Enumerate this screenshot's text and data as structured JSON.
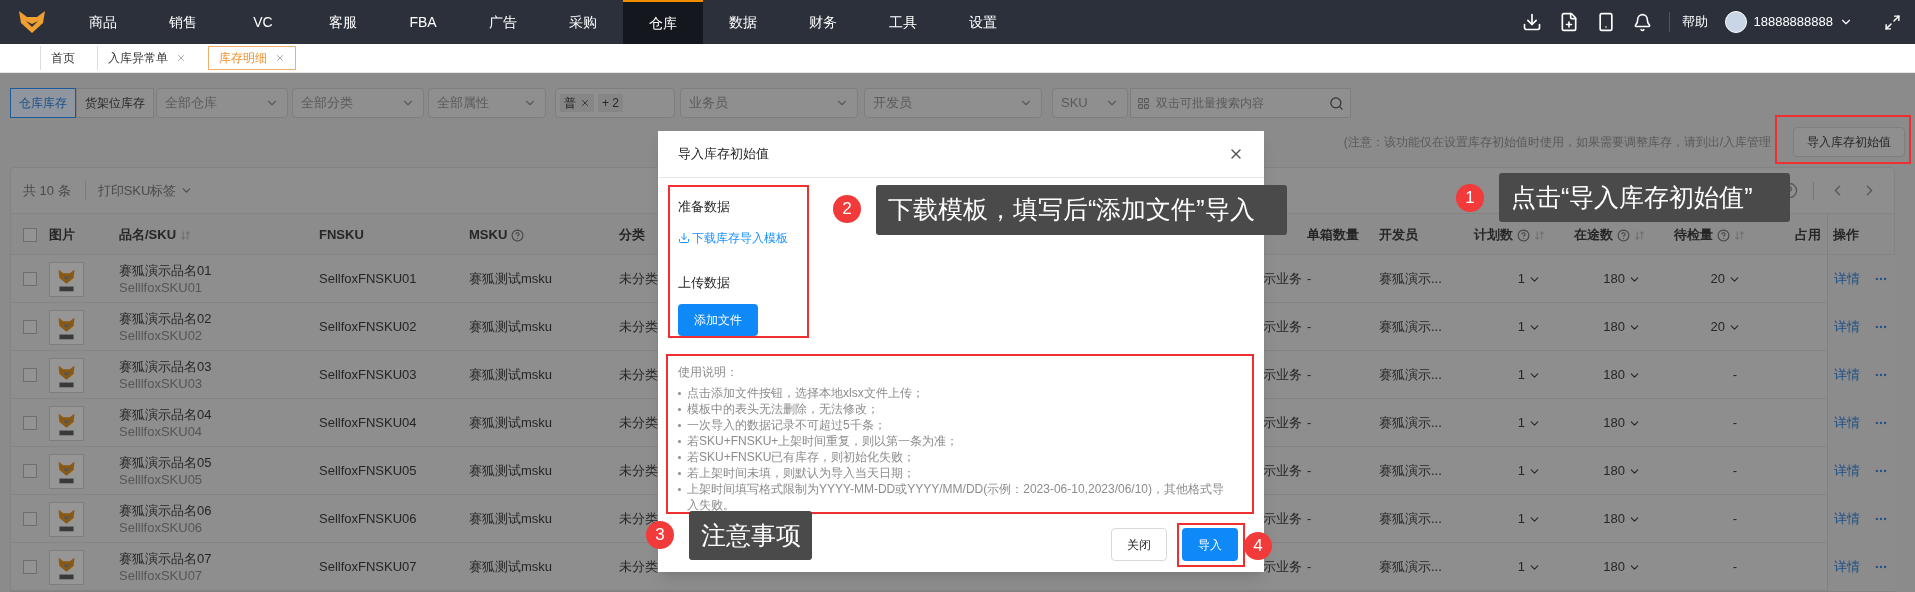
{
  "nav": {
    "items": [
      {
        "label": "商品",
        "selected": false
      },
      {
        "label": "销售",
        "selected": false
      },
      {
        "label": "VC",
        "selected": false
      },
      {
        "label": "客服",
        "selected": false
      },
      {
        "label": "FBA",
        "selected": false
      },
      {
        "label": "广告",
        "selected": false
      },
      {
        "label": "采购",
        "selected": false
      },
      {
        "label": "仓库",
        "selected": true
      },
      {
        "label": "数据",
        "selected": false
      },
      {
        "label": "财务",
        "selected": false
      },
      {
        "label": "工具",
        "selected": false
      },
      {
        "label": "设置",
        "selected": false
      }
    ],
    "help": "帮助",
    "user": "18888888888"
  },
  "tabs": [
    {
      "label": "首页",
      "closable": false,
      "selected": false
    },
    {
      "label": "入库异常单",
      "closable": true,
      "selected": false
    },
    {
      "label": "库存明细",
      "closable": true,
      "selected": true
    }
  ],
  "filters": {
    "views": [
      {
        "label": "仓库库存",
        "selected": true
      },
      {
        "label": "货架位库存",
        "selected": false
      }
    ],
    "selects": [
      {
        "placeholder": "全部仓库"
      },
      {
        "placeholder": "全部分类"
      },
      {
        "placeholder": "全部属性"
      }
    ],
    "tag_select": {
      "tag": "普",
      "more": "+ 2"
    },
    "people": [
      {
        "placeholder": "业务员"
      },
      {
        "placeholder": "开发员"
      }
    ],
    "search_type": "SKU",
    "search": {
      "placeholder": "双击可批量搜索内容"
    }
  },
  "notice": "(注意：该功能仅在设置库存初始值时使用，如果需要调整库存，请到出/入库管理",
  "import_button": "导入库存初始值",
  "table": {
    "total": "共 10 条",
    "print_button": "打印SKU标签",
    "all_checked": false,
    "columns": [
      {
        "label": "图片",
        "help": false,
        "sortable": false
      },
      {
        "label": "品名/SKU",
        "help": false,
        "sortable": true
      },
      {
        "label": "FNSKU",
        "help": false,
        "sortable": false
      },
      {
        "label": "MSKU",
        "help": true,
        "sortable": false
      },
      {
        "label": "分类",
        "help": false,
        "sortable": false
      },
      {
        "label": "单箱数量",
        "help": false,
        "sortable": false
      },
      {
        "label": "开发员",
        "help": false,
        "sortable": false
      },
      {
        "label": "计划数",
        "help": true,
        "sortable": true
      },
      {
        "label": "在途数",
        "help": true,
        "sortable": true
      },
      {
        "label": "待检量",
        "help": true,
        "sortable": true
      },
      {
        "label": "占用"
      },
      {
        "label": "操作",
        "help": false,
        "sortable": false
      }
    ],
    "rows": [
      {
        "checked": false,
        "name": "赛狐演示品名01",
        "sku": "SelllfoxSKU01",
        "fnsku": "SellfoxFNSKU01",
        "msku": "赛狐测试msku",
        "category": "未分类",
        "column_7": "示业务",
        "box_qty": "-",
        "developer": "赛狐演示...",
        "planned": "1",
        "in_transit": "180",
        "pending": "20",
        "pending_expandable": true,
        "action": "详情"
      },
      {
        "checked": false,
        "name": "赛狐演示品名02",
        "sku": "SelllfoxSKU02",
        "fnsku": "SellfoxFNSKU02",
        "msku": "赛狐测试msku",
        "category": "未分类",
        "column_7": "示业务",
        "box_qty": "-",
        "developer": "赛狐演示...",
        "planned": "1",
        "in_transit": "180",
        "pending": "20",
        "pending_expandable": true,
        "action": "详情"
      },
      {
        "checked": false,
        "name": "赛狐演示品名03",
        "sku": "SelllfoxSKU03",
        "fnsku": "SellfoxFNSKU03",
        "msku": "赛狐测试msku",
        "category": "未分类",
        "column_7": "示业务",
        "box_qty": "-",
        "developer": "赛狐演示...",
        "planned": "1",
        "in_transit": "180",
        "pending": "-",
        "pending_expandable": false,
        "action": "详情"
      },
      {
        "checked": false,
        "name": "赛狐演示品名04",
        "sku": "SelllfoxSKU04",
        "fnsku": "SellfoxFNSKU04",
        "msku": "赛狐测试msku",
        "category": "未分类",
        "column_7": "示业务",
        "box_qty": "-",
        "developer": "赛狐演示...",
        "planned": "1",
        "in_transit": "180",
        "pending": "-",
        "pending_expandable": false,
        "action": "详情"
      },
      {
        "checked": false,
        "name": "赛狐演示品名05",
        "sku": "SelllfoxSKU05",
        "fnsku": "SellfoxFNSKU05",
        "msku": "赛狐测试msku",
        "category": "未分类",
        "column_7": "示业务",
        "box_qty": "-",
        "developer": "赛狐演示...",
        "planned": "1",
        "in_transit": "180",
        "pending": "-",
        "pending_expandable": false,
        "action": "详情"
      },
      {
        "checked": false,
        "name": "赛狐演示品名06",
        "sku": "SelllfoxSKU06",
        "fnsku": "SellfoxFNSKU06",
        "msku": "赛狐测试msku",
        "category": "未分类",
        "column_7": "示业务",
        "box_qty": "-",
        "developer": "赛狐演示...",
        "planned": "1",
        "in_transit": "180",
        "pending": "-",
        "pending_expandable": false,
        "action": "详情"
      },
      {
        "checked": false,
        "name": "赛狐演示品名07",
        "sku": "SelllfoxSKU07",
        "fnsku": "SellfoxFNSKU07",
        "msku": "赛狐测试msku",
        "category": "未分类",
        "column_7": "示业务",
        "box_qty": "-",
        "developer": "赛狐演示...",
        "planned": "1",
        "in_transit": "180",
        "pending": "-",
        "pending_expandable": false,
        "action": "详情"
      }
    ]
  },
  "modal": {
    "title": "导入库存初始值",
    "prepare_label": "准备数据",
    "download_link": "下载库存导入模板",
    "upload_label": "上传数据",
    "add_file_button": "添加文件",
    "instructions_title": "使用说明：",
    "instructions": [
      "点击添加文件按钮，选择本地xlsx文件上传；",
      "模板中的表头无法删除，无法修改；",
      "一次导入的数据记录不可超过5千条；",
      "若SKU+FNSKU+上架时间重复，则以第一条为准；",
      "若SKU+FNSKU已有库存，则初始化失败；",
      "若上架时间未填，则默认为导入当天日期；",
      "上架时间填写格式限制为YYYY-MM-DD或YYYY/MM/DD(示例：2023-06-10,2023/06/10)，其他格式导入失败。"
    ],
    "buttons": [
      {
        "label": "关闭",
        "kind": "default"
      },
      {
        "label": "导入",
        "kind": "primary"
      }
    ]
  },
  "annotations": [
    {
      "number": "1",
      "text": "点击“导入库存初始值”"
    },
    {
      "number": "2",
      "text": "下载模板，填写后“添加文件”导入"
    },
    {
      "number": "3",
      "text": "注意事项"
    },
    {
      "number": "4"
    }
  ]
}
